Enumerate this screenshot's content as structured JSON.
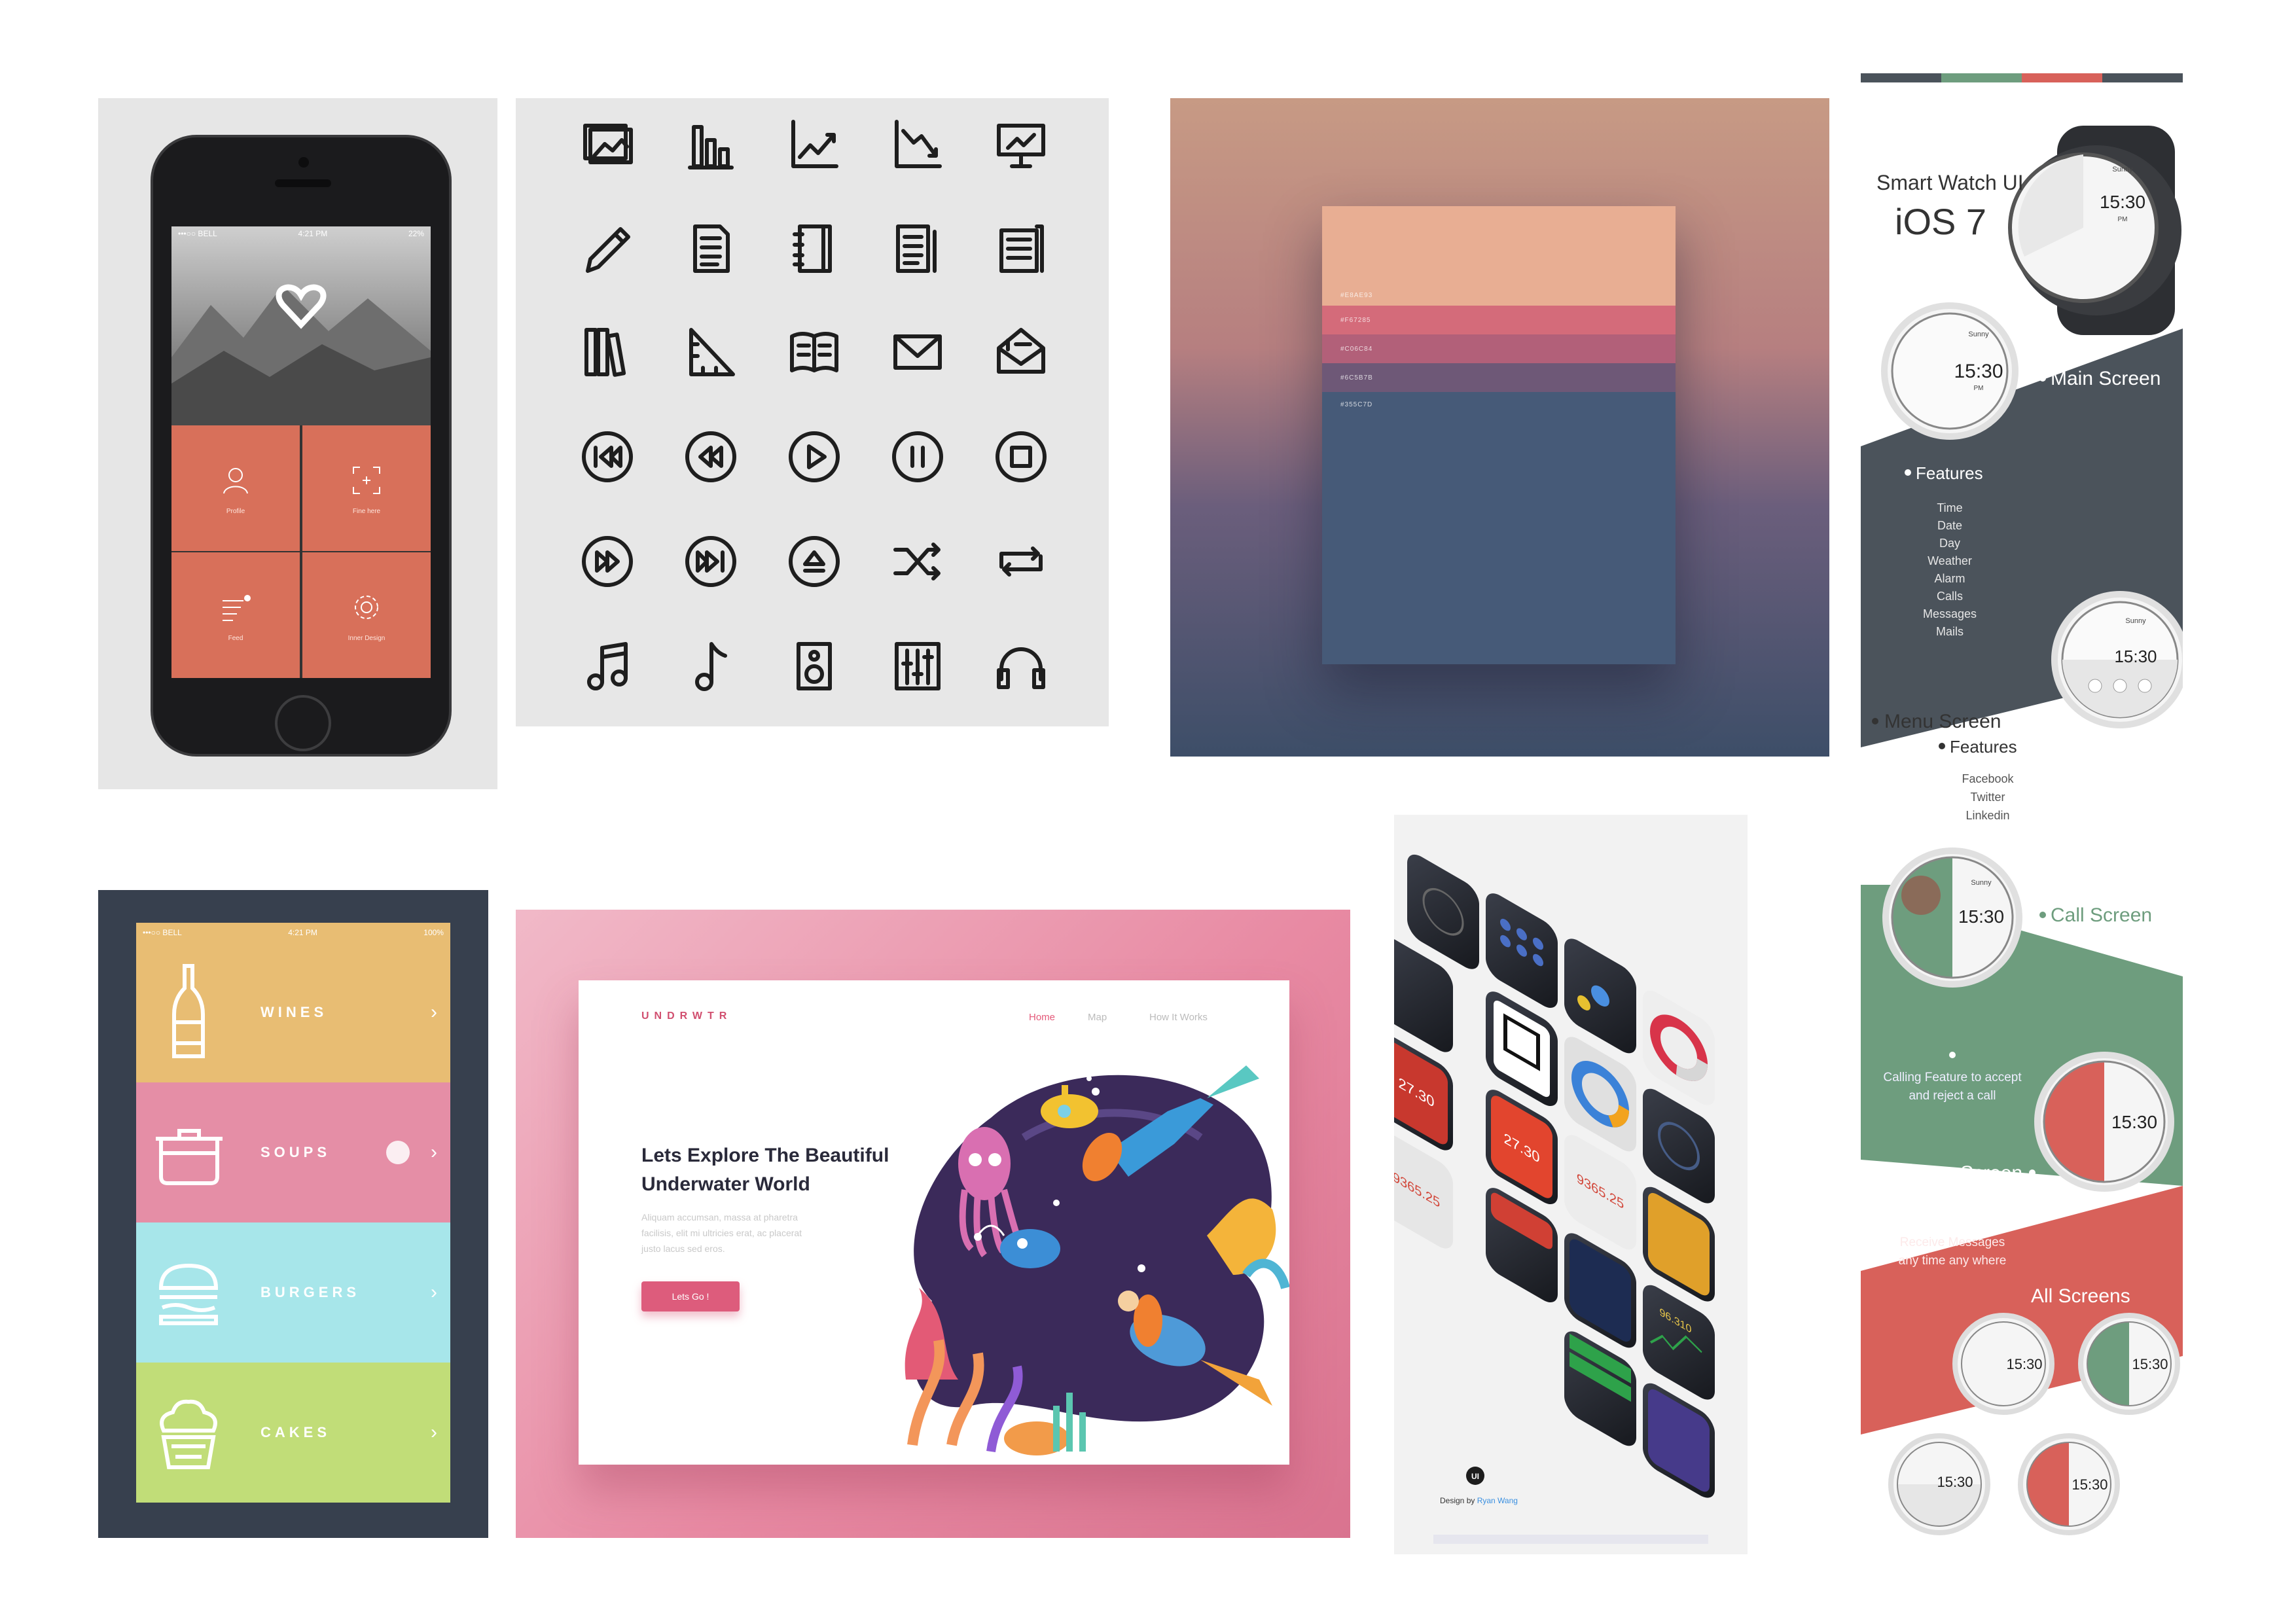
{
  "phone": {
    "status_carrier": "•••○○ BELL",
    "status_time": "4:21 PM",
    "status_battery": "22%",
    "tiles": [
      {
        "label": "Profile",
        "icon": "user-icon"
      },
      {
        "label": "Fine here",
        "icon": "focus-icon"
      },
      {
        "label": "Feed",
        "icon": "list-icon"
      },
      {
        "label": "Inner Design",
        "icon": "gear-icon"
      }
    ],
    "logo": "heart-logo"
  },
  "icon_grid": {
    "icons": [
      "image-icon",
      "bar-chart-icon",
      "line-chart-icon",
      "decline-chart-icon",
      "presentation-icon",
      "pencil-icon",
      "document-icon",
      "notebook-icon",
      "file-text-icon",
      "newspaper-icon",
      "books-icon",
      "ruler-triangle-icon",
      "open-book-icon",
      "mail-icon",
      "open-mail-icon",
      "skip-back-icon",
      "rewind-icon",
      "play-icon",
      "pause-icon",
      "stop-icon",
      "fast-forward-icon",
      "skip-forward-icon",
      "eject-icon",
      "shuffle-icon",
      "repeat-icon",
      "music-notes-icon",
      "music-note-icon",
      "speaker-icon",
      "equalizer-icon",
      "headphones-icon"
    ]
  },
  "palette": {
    "swatches": [
      {
        "hex": "#E8AE93",
        "label": "#E8AE93"
      },
      {
        "hex": "#D46B7A",
        "label": "#F67285"
      },
      {
        "hex": "#B26079",
        "label": "#C06C84"
      },
      {
        "hex": "#6E5877",
        "label": "#6C5B7B"
      },
      {
        "hex": "#465A78",
        "label": "#355C7D"
      }
    ]
  },
  "watch": {
    "title": "Smart Watch UI",
    "subtitle": "iOS  7",
    "main_screen": "Main Screen",
    "features_heading": "Features",
    "features": [
      "Time",
      "Date",
      "Day",
      "Weather",
      "Alarm",
      "Calls",
      "Messages",
      "Mails"
    ],
    "menu_screen": "Menu Screen",
    "menu_features_heading": "Features",
    "menu_features": [
      "Facebook",
      "Twitter",
      "Linkedin"
    ],
    "call_screen": "Call Screen",
    "call_desc_1": "Calling Feature to accept",
    "call_desc_2": "and reject a call",
    "message_screen": "Message Screen",
    "message_desc_1": "Receive Messages",
    "message_desc_2": "any time any where",
    "all_screens": "All Screens",
    "time": "15:30",
    "pm": "PM",
    "weather": "Sunny",
    "colors": {
      "dark": "#4b535b",
      "green": "#6e9d7e",
      "red": "#d8615a"
    }
  },
  "food": {
    "status_carrier": "•••○○ BELL",
    "status_time": "4:21 PM",
    "status_battery": "100%",
    "rows": [
      {
        "label": "WINES",
        "color": "#e8bd73",
        "icon": "wine-bottle-icon"
      },
      {
        "label": "SOUPS",
        "color": "#e58ea6",
        "icon": "soup-pot-icon"
      },
      {
        "label": "BURGERS",
        "color": "#a7e6ea",
        "icon": "burger-icon"
      },
      {
        "label": "CAKES",
        "color": "#c1dd78",
        "icon": "cupcake-icon"
      }
    ],
    "chevron": "›"
  },
  "underwater": {
    "logo": "UNDRWTR",
    "nav": [
      "Home",
      "Map",
      "How It Works"
    ],
    "headline_1": "Lets Explore The Beautiful",
    "headline_2": "Underwater World",
    "body_1": "Aliquam accumsan, massa at pharetra",
    "body_2": "facilisis, elit mi ultricies erat, ac placerat",
    "body_3": "justo lacus sed eros.",
    "cta": "Lets Go !"
  },
  "apple_watch": {
    "numbers": [
      "27.30",
      "9365.25",
      "9365.25",
      "27.30",
      "96.310"
    ],
    "design_by_prefix": "Design by ",
    "design_by_name": "Ryan Wang",
    "logo": "UI"
  }
}
